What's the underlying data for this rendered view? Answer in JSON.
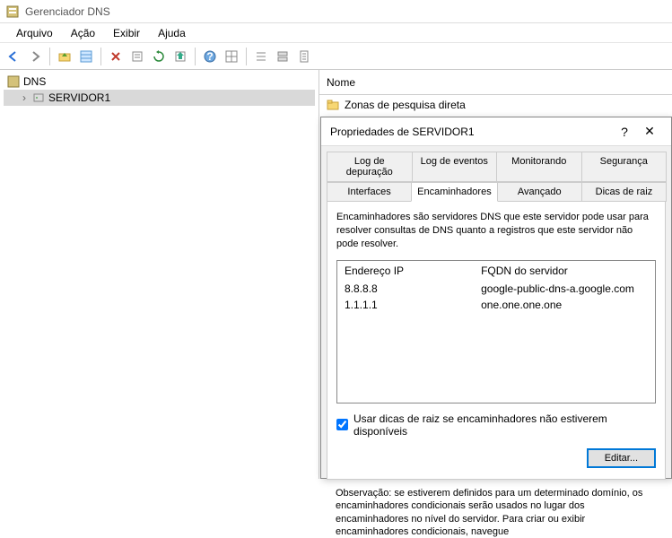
{
  "window": {
    "title": "Gerenciador DNS"
  },
  "menu": {
    "arquivo": "Arquivo",
    "acao": "Ação",
    "exibir": "Exibir",
    "ajuda": "Ajuda"
  },
  "tree": {
    "root": "DNS",
    "server": "SERVIDOR1"
  },
  "right": {
    "header": "Nome",
    "row1": "Zonas de pesquisa direta"
  },
  "dialog": {
    "title": "Propriedades de SERVIDOR1",
    "tabs_top": {
      "debug": "Log de depuração",
      "events": "Log de eventos",
      "monitor": "Monitorando",
      "security": "Segurança"
    },
    "tabs_bottom": {
      "interfaces": "Interfaces",
      "forwarders": "Encaminhadores",
      "advanced": "Avançado",
      "roothints": "Dicas de raiz"
    },
    "desc": "Encaminhadores são servidores DNS que este servidor pode usar para resolver consultas de DNS quanto a registros que este servidor não pode resolver.",
    "list": {
      "col_ip": "Endereço IP",
      "col_fqdn": "FQDN do servidor",
      "rows": [
        {
          "ip": "8.8.8.8",
          "fqdn": "google-public-dns-a.google.com"
        },
        {
          "ip": "1.1.1.1",
          "fqdn": "one.one.one.one"
        }
      ]
    },
    "checkbox": "Usar dicas de raiz se encaminhadores não estiverem disponíveis",
    "edit": "Editar...",
    "obs": "Observação: se estiverem definidos para um determinado domínio, os encaminhadores condicionais serão usados no lugar dos encaminhadores no nível do servidor. Para criar ou exibir encaminhadores condicionais, navegue"
  }
}
